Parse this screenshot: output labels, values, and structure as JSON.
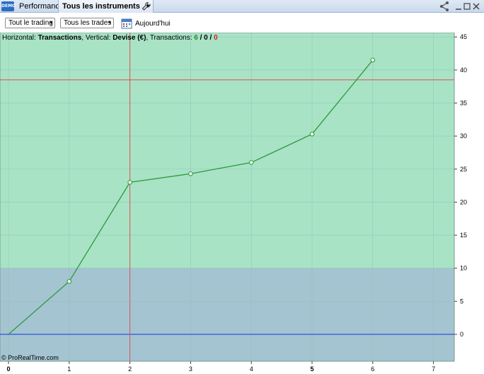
{
  "titlebar": {
    "logo_text": "DEMO",
    "tab_performance": "Performance",
    "tab_instruments": "Tous les instruments",
    "caret": "▾",
    "icons": [
      "share-icon",
      "minimize-icon",
      "maximize-icon",
      "close-icon",
      "wrench-icon"
    ]
  },
  "toolbar": {
    "trading_select": "Tout le trading",
    "trades_select": "Tous les trades",
    "today_label": "Aujourd'hui",
    "caret": "▾"
  },
  "info": {
    "horizontal_label": "Horizontal: ",
    "horizontal_value": "Transactions",
    "vertical_label": ", Vertical: ",
    "vertical_value": "Devise (€)",
    "transactions_label": ", Transactions: ",
    "count_total": "6",
    "sep1": " / ",
    "count_mid": "0",
    "sep2": " / ",
    "count_loss": "0"
  },
  "copyright": "© ProRealTime.com",
  "colors": {
    "bg_top": "#a8e3c6",
    "bg_bottom": "#a4c4d2",
    "line": "#2e9a3a",
    "crosshair": "#e05050",
    "zero_line": "#3050e0"
  },
  "chart_data": {
    "type": "line",
    "x": [
      0,
      1,
      2,
      3,
      4,
      5,
      6
    ],
    "series": [
      {
        "values": [
          0,
          8.0,
          23.0,
          24.3,
          26.0,
          30.3,
          41.5
        ]
      }
    ],
    "xlim": [
      0,
      7.35
    ],
    "ylim": [
      -4,
      45
    ],
    "x_ticks": [
      0,
      1,
      2,
      3,
      4,
      5,
      6,
      7
    ],
    "x_tick_labels": [
      "0",
      "1",
      "2",
      "3",
      "4",
      "5",
      "6",
      "7"
    ],
    "y_ticks": [
      0,
      5,
      10,
      15,
      20,
      25,
      30,
      35,
      40,
      45
    ],
    "y_tick_labels": [
      "0",
      "5",
      "10",
      "15",
      "20",
      "25",
      "30",
      "35",
      "40",
      "45"
    ],
    "zone_threshold": 10,
    "crosshair_x": 2,
    "crosshair_y": 38.5,
    "grid": true,
    "y_axis_position": "right"
  }
}
